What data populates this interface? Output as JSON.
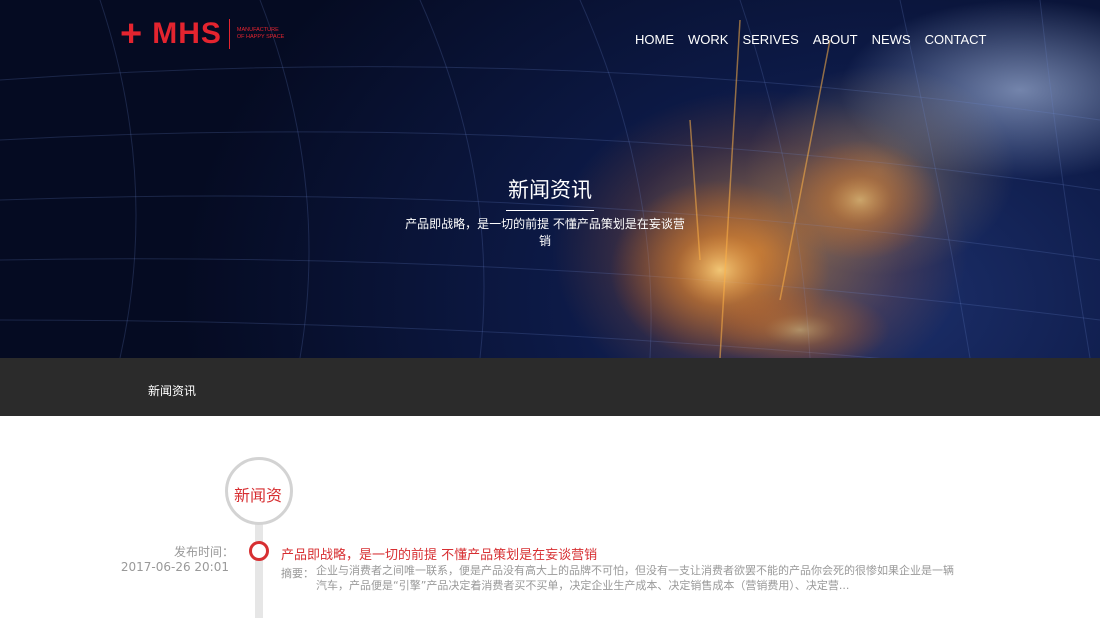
{
  "logo": {
    "plus": "+",
    "wordmark": "MHS",
    "tagline": "MANUFACTURE OF HAPPY SPACE"
  },
  "nav": {
    "items": [
      "HOME",
      "WORK",
      "SERIVES",
      "ABOUT",
      "NEWS",
      "CONTACT"
    ]
  },
  "hero": {
    "title": "新闻资讯",
    "subtitle": "产品即战略，是一切的前提 不懂产品策划是在妄谈营销"
  },
  "breadcrumb": {
    "current": "新闻资讯"
  },
  "timeline": {
    "heading": "新闻资"
  },
  "news": [
    {
      "date_label": "发布时间：",
      "date": "2017-06-26 20:01",
      "title": "产品即战略，是一切的前提 不懂产品策划是在妄谈营销",
      "summary_label": "摘要：",
      "summary": "企业与消费者之间唯一联系，便是产品没有高大上的品牌不可怕，但没有一支让消费者欲罢不能的产品你会死的很惨如果企业是一辆汽车，产品便是“引擎”产品决定着消费者买不买单，决定企业生产成本、决定销售成本（营销费用）、决定营..."
    }
  ],
  "colors": {
    "accent": "#e4242f",
    "timeline_red": "#d72f32",
    "bar": "#2b2b2b",
    "muted": "#999999"
  }
}
